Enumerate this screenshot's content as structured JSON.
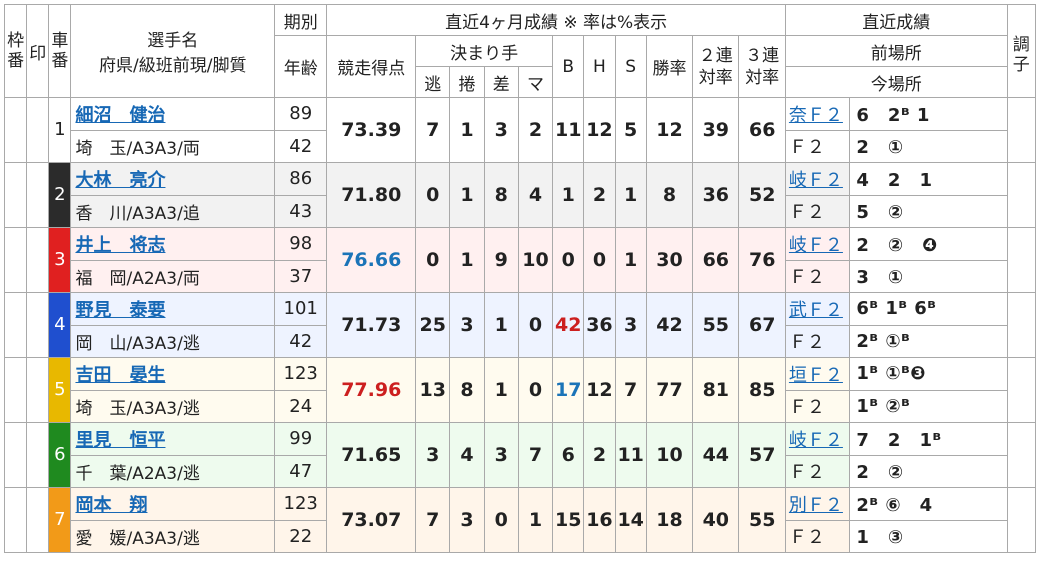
{
  "headers": {
    "waku": "枠番",
    "mark": "印",
    "car": "車番",
    "player_name": "選手名",
    "player_sub": "府県/級班前現/脚質",
    "term": "期別",
    "age": "年齢",
    "recent4m": "直近4ヶ月成績 ※ 率は%表示",
    "score": "競走得点",
    "kimarite": "決まり手",
    "nige": "逃",
    "makuri": "捲",
    "sashi": "差",
    "mark_k": "マ",
    "b": "B",
    "h": "H",
    "s": "S",
    "win": "勝率",
    "rentai2": "２連対率",
    "rentai3": "３連対率",
    "recent_results": "直近成績",
    "prev_venue": "前場所",
    "curr_venue": "今場所",
    "condition": "調子"
  },
  "riders": [
    {
      "waku": "",
      "waku_color": "#ffffff",
      "car": "1",
      "name": "細沼　健治",
      "info": "埼　玉/A3A3/両",
      "term": "89",
      "age": "42",
      "score": "73.39",
      "score_color": "",
      "nige": "7",
      "makuri": "1",
      "sashi": "3",
      "mark": "2",
      "b": "11",
      "b_color": "",
      "h": "12",
      "s": "5",
      "win": "12",
      "r2": "39",
      "r3": "66",
      "prev_venue": "奈Ｆ２",
      "prev_result": "6　2ᴮ 1",
      "curr_venue": "Ｆ２",
      "curr_result": "2　①"
    },
    {
      "waku": "2",
      "waku_color": "#2b2b2b",
      "car": "",
      "name": "大林　亮介",
      "info": "香　川/A3A3/追",
      "term": "86",
      "age": "43",
      "score": "71.80",
      "score_color": "",
      "nige": "0",
      "makuri": "1",
      "sashi": "8",
      "mark": "4",
      "b": "1",
      "b_color": "",
      "h": "2",
      "s": "1",
      "win": "8",
      "r2": "36",
      "r3": "52",
      "prev_venue": "岐Ｆ２",
      "prev_result": "4　2　1",
      "curr_venue": "Ｆ２",
      "curr_result": "5　②"
    },
    {
      "waku": "3",
      "waku_color": "#e02020",
      "car": "",
      "name": "井上　将志",
      "info": "福　岡/A2A3/両",
      "term": "98",
      "age": "37",
      "score": "76.66",
      "score_color": "blue",
      "nige": "0",
      "makuri": "1",
      "sashi": "9",
      "mark": "10",
      "b": "0",
      "b_color": "",
      "h": "0",
      "s": "1",
      "win": "30",
      "r2": "66",
      "r3": "76",
      "prev_venue": "岐Ｆ２",
      "prev_result": "2　②　❹",
      "curr_venue": "Ｆ２",
      "curr_result": "3　①"
    },
    {
      "waku": "4",
      "waku_color": "#1f4fcf",
      "car": "",
      "name": "野見　泰要",
      "info": "岡　山/A3A3/逃",
      "term": "101",
      "age": "42",
      "score": "71.73",
      "score_color": "",
      "nige": "25",
      "makuri": "3",
      "sashi": "1",
      "mark": "0",
      "b": "42",
      "b_color": "red",
      "h": "36",
      "s": "3",
      "win": "42",
      "r2": "55",
      "r3": "67",
      "prev_venue": "武Ｆ２",
      "prev_result": "6ᴮ 1ᴮ 6ᴮ",
      "curr_venue": "Ｆ２",
      "curr_result": "2ᴮ ①ᴮ"
    },
    {
      "waku": "5",
      "waku_color": "#e8b800",
      "car": "",
      "name": "吉田　晏生",
      "info": "埼　玉/A3A3/逃",
      "term": "123",
      "age": "24",
      "score": "77.96",
      "score_color": "red",
      "nige": "13",
      "makuri": "8",
      "sashi": "1",
      "mark": "0",
      "b": "17",
      "b_color": "blue",
      "h": "12",
      "s": "7",
      "win": "77",
      "r2": "81",
      "r3": "85",
      "prev_venue": "垣Ｆ２",
      "prev_result": "1ᴮ ①ᴮ❸",
      "curr_venue": "Ｆ２",
      "curr_result": "1ᴮ ②ᴮ"
    },
    {
      "waku": "6",
      "waku_color": "#1f8a1f",
      "car": "",
      "name": "里見　恒平",
      "info": "千　葉/A2A3/逃",
      "term": "99",
      "age": "47",
      "score": "71.65",
      "score_color": "",
      "nige": "3",
      "makuri": "4",
      "sashi": "3",
      "mark": "7",
      "b": "6",
      "b_color": "",
      "h": "2",
      "s": "11",
      "win": "10",
      "r2": "44",
      "r3": "57",
      "prev_venue": "岐Ｆ２",
      "prev_result": "7　2　1ᴮ",
      "curr_venue": "Ｆ２",
      "curr_result": "2　②"
    },
    {
      "waku": "7",
      "waku_color": "#f29a18",
      "car": "",
      "name": "岡本　翔",
      "info": "愛　媛/A3A3/逃",
      "term": "123",
      "age": "22",
      "score": "73.07",
      "score_color": "",
      "nige": "7",
      "makuri": "3",
      "sashi": "0",
      "mark": "1",
      "b": "15",
      "b_color": "",
      "h": "16",
      "s": "14",
      "win": "18",
      "r2": "40",
      "r3": "55",
      "prev_venue": "別Ｆ２",
      "prev_result": "2ᴮ ⑥　4",
      "curr_venue": "Ｆ２",
      "curr_result": "1　③"
    }
  ]
}
